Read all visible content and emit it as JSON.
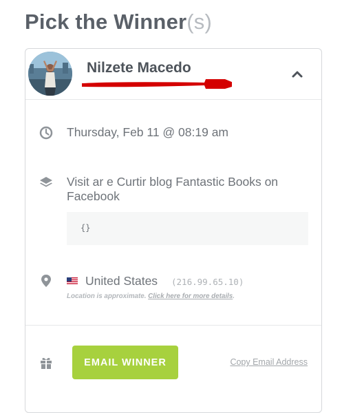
{
  "heading": {
    "title": "Pick the Winner",
    "suffix": "(s)"
  },
  "winner": {
    "name": "Nilzete Macedo"
  },
  "entry": {
    "datetime": "Thursday, Feb 11 @ 08:19 am",
    "action": "Visit ar e Curtir blog Fantastic Books on Facebook",
    "data": "{}"
  },
  "location": {
    "country": "United States",
    "ip": "(216.99.65.10)",
    "note_prefix": "Location is approximate.",
    "note_link": "Click here for more details",
    "note_suffix": "."
  },
  "actions": {
    "email_label": "EMAIL WINNER",
    "copy_label": "Copy Email Address"
  },
  "colors": {
    "accent_green": "#a7d13e",
    "redaction": "#d40000"
  },
  "icons": [
    "clock-icon",
    "layers-icon",
    "map-pin-icon",
    "us-flag-icon",
    "gift-icon",
    "chevron-up-icon"
  ]
}
